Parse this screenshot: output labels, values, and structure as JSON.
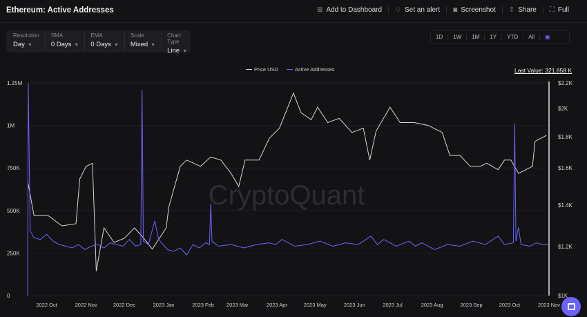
{
  "header": {
    "title": "Ethereum: Active Addresses",
    "actions": [
      {
        "label": "Add to Dashboard",
        "icon": "dashboard-add-icon"
      },
      {
        "label": "Set an alert",
        "icon": "bell-icon"
      },
      {
        "label": "Screenshot",
        "icon": "camera-icon"
      },
      {
        "label": "Share",
        "icon": "share-icon"
      },
      {
        "label": "Full",
        "icon": "fullscreen-icon"
      }
    ]
  },
  "controls": [
    {
      "label": "Resolution",
      "value": "Day"
    },
    {
      "label": "SMA",
      "value": "0 Days"
    },
    {
      "label": "EMA",
      "value": "0 Days"
    },
    {
      "label": "Scale",
      "value": "Mixed"
    },
    {
      "label": "Chart Type",
      "value": "Line"
    }
  ],
  "ranges": [
    "1D",
    "1W",
    "1M",
    "1Y",
    "YTD",
    "All"
  ],
  "last_value": "Last Value: 321.858 K",
  "watermark": "CryptoQuant",
  "colors": {
    "price": "#d8d8d8",
    "addresses": "#6c63ff",
    "accent": "#6c63ff"
  },
  "chart_data": {
    "type": "line",
    "legend": [
      "Price USD",
      "Active Addresses"
    ],
    "legend_placement": "top-center",
    "x_unit": "days since 2022-09-16",
    "xticks": [
      {
        "day": 15,
        "label": "2022 Oct"
      },
      {
        "day": 46,
        "label": "2022 Nov"
      },
      {
        "day": 76,
        "label": "2022 Dec"
      },
      {
        "day": 107,
        "label": "2023 Jan"
      },
      {
        "day": 138,
        "label": "2023 Feb"
      },
      {
        "day": 165,
        "label": "2023 Mar"
      },
      {
        "day": 196,
        "label": "2023 Apr"
      },
      {
        "day": 226,
        "label": "2023 May"
      },
      {
        "day": 257,
        "label": "2023 Jun"
      },
      {
        "day": 287,
        "label": "2023 Jul"
      },
      {
        "day": 318,
        "label": "2023 Aug"
      },
      {
        "day": 349,
        "label": "2023 Sep"
      },
      {
        "day": 379,
        "label": "2023 Oct"
      },
      {
        "day": 410,
        "label": "2023 Nov"
      }
    ],
    "xlim": [
      0,
      410
    ],
    "left_axis": {
      "label": "Active Addresses",
      "ylim": [
        0,
        1250000
      ],
      "ticks": [
        {
          "v": 0,
          "label": "0"
        },
        {
          "v": 250000,
          "label": "250K"
        },
        {
          "v": 500000,
          "label": "500K"
        },
        {
          "v": 750000,
          "label": "750K"
        },
        {
          "v": 1000000,
          "label": "1M"
        },
        {
          "v": 1250000,
          "label": "1.25M"
        }
      ]
    },
    "right_axis": {
      "label": "Price USD",
      "ylim": [
        1000,
        2200
      ],
      "ticks": [
        {
          "v": 1000,
          "label": "$1K"
        },
        {
          "v": 1200,
          "label": "$1.2K"
        },
        {
          "v": 1400,
          "label": "$1.4K"
        },
        {
          "v": 1600,
          "label": "$1.6K"
        },
        {
          "v": 1800,
          "label": "$1.8K"
        },
        {
          "v": 2000,
          "label": "$2K"
        },
        {
          "v": 2200,
          "label": "$2.2K"
        }
      ]
    },
    "series": [
      {
        "name": "Price USD",
        "axis": "right",
        "points": [
          [
            0,
            1530
          ],
          [
            5,
            1350
          ],
          [
            16,
            1350
          ],
          [
            27,
            1300
          ],
          [
            38,
            1310
          ],
          [
            41,
            1540
          ],
          [
            46,
            1610
          ],
          [
            51,
            1630
          ],
          [
            54,
            1100
          ],
          [
            60,
            1290
          ],
          [
            68,
            1220
          ],
          [
            76,
            1240
          ],
          [
            84,
            1290
          ],
          [
            90,
            1250
          ],
          [
            98,
            1190
          ],
          [
            109,
            1290
          ],
          [
            111,
            1390
          ],
          [
            120,
            1610
          ],
          [
            125,
            1650
          ],
          [
            136,
            1610
          ],
          [
            144,
            1670
          ],
          [
            152,
            1650
          ],
          [
            160,
            1570
          ],
          [
            166,
            1500
          ],
          [
            171,
            1650
          ],
          [
            182,
            1650
          ],
          [
            190,
            1790
          ],
          [
            198,
            1860
          ],
          [
            209,
            2120
          ],
          [
            215,
            1970
          ],
          [
            223,
            1920
          ],
          [
            228,
            2010
          ],
          [
            236,
            1900
          ],
          [
            245,
            1930
          ],
          [
            255,
            1830
          ],
          [
            264,
            1860
          ],
          [
            269,
            1650
          ],
          [
            274,
            1840
          ],
          [
            285,
            2010
          ],
          [
            293,
            1900
          ],
          [
            304,
            1900
          ],
          [
            315,
            1880
          ],
          [
            326,
            1830
          ],
          [
            332,
            1680
          ],
          [
            340,
            1680
          ],
          [
            348,
            1610
          ],
          [
            356,
            1610
          ],
          [
            361,
            1630
          ],
          [
            370,
            1590
          ],
          [
            375,
            1650
          ],
          [
            380,
            1650
          ],
          [
            386,
            1570
          ],
          [
            397,
            1610
          ],
          [
            399,
            1770
          ],
          [
            408,
            1810
          ]
        ]
      },
      {
        "name": "Active Addresses",
        "axis": "left",
        "points": [
          [
            0,
            0
          ],
          [
            0.5,
            1250000
          ],
          [
            2,
            380000
          ],
          [
            5,
            340000
          ],
          [
            10,
            330000
          ],
          [
            15,
            360000
          ],
          [
            20,
            320000
          ],
          [
            25,
            300000
          ],
          [
            30,
            290000
          ],
          [
            35,
            280000
          ],
          [
            40,
            300000
          ],
          [
            45,
            270000
          ],
          [
            50,
            290000
          ],
          [
            55,
            300000
          ],
          [
            60,
            280000
          ],
          [
            65,
            310000
          ],
          [
            70,
            300000
          ],
          [
            75,
            290000
          ],
          [
            80,
            330000
          ],
          [
            85,
            290000
          ],
          [
            89,
            300000
          ],
          [
            90,
            1210000
          ],
          [
            91,
            320000
          ],
          [
            95,
            300000
          ],
          [
            100,
            440000
          ],
          [
            103,
            330000
          ],
          [
            110,
            270000
          ],
          [
            115,
            260000
          ],
          [
            120,
            280000
          ],
          [
            125,
            240000
          ],
          [
            130,
            300000
          ],
          [
            135,
            280000
          ],
          [
            140,
            310000
          ],
          [
            143,
            300000
          ],
          [
            144,
            540000
          ],
          [
            145,
            320000
          ],
          [
            150,
            290000
          ],
          [
            160,
            300000
          ],
          [
            170,
            280000
          ],
          [
            180,
            300000
          ],
          [
            190,
            310000
          ],
          [
            195,
            300000
          ],
          [
            200,
            330000
          ],
          [
            210,
            290000
          ],
          [
            220,
            300000
          ],
          [
            230,
            320000
          ],
          [
            240,
            290000
          ],
          [
            250,
            310000
          ],
          [
            260,
            300000
          ],
          [
            270,
            350000
          ],
          [
            275,
            300000
          ],
          [
            280,
            330000
          ],
          [
            290,
            290000
          ],
          [
            300,
            320000
          ],
          [
            305,
            290000
          ],
          [
            310,
            310000
          ],
          [
            320,
            270000
          ],
          [
            330,
            300000
          ],
          [
            340,
            290000
          ],
          [
            350,
            320000
          ],
          [
            360,
            300000
          ],
          [
            370,
            350000
          ],
          [
            375,
            300000
          ],
          [
            382,
            310000
          ],
          [
            383,
            1010000
          ],
          [
            384,
            320000
          ],
          [
            386,
            400000
          ],
          [
            388,
            300000
          ],
          [
            395,
            290000
          ],
          [
            400,
            310000
          ],
          [
            405,
            300000
          ],
          [
            410,
            300000
          ]
        ]
      }
    ]
  }
}
